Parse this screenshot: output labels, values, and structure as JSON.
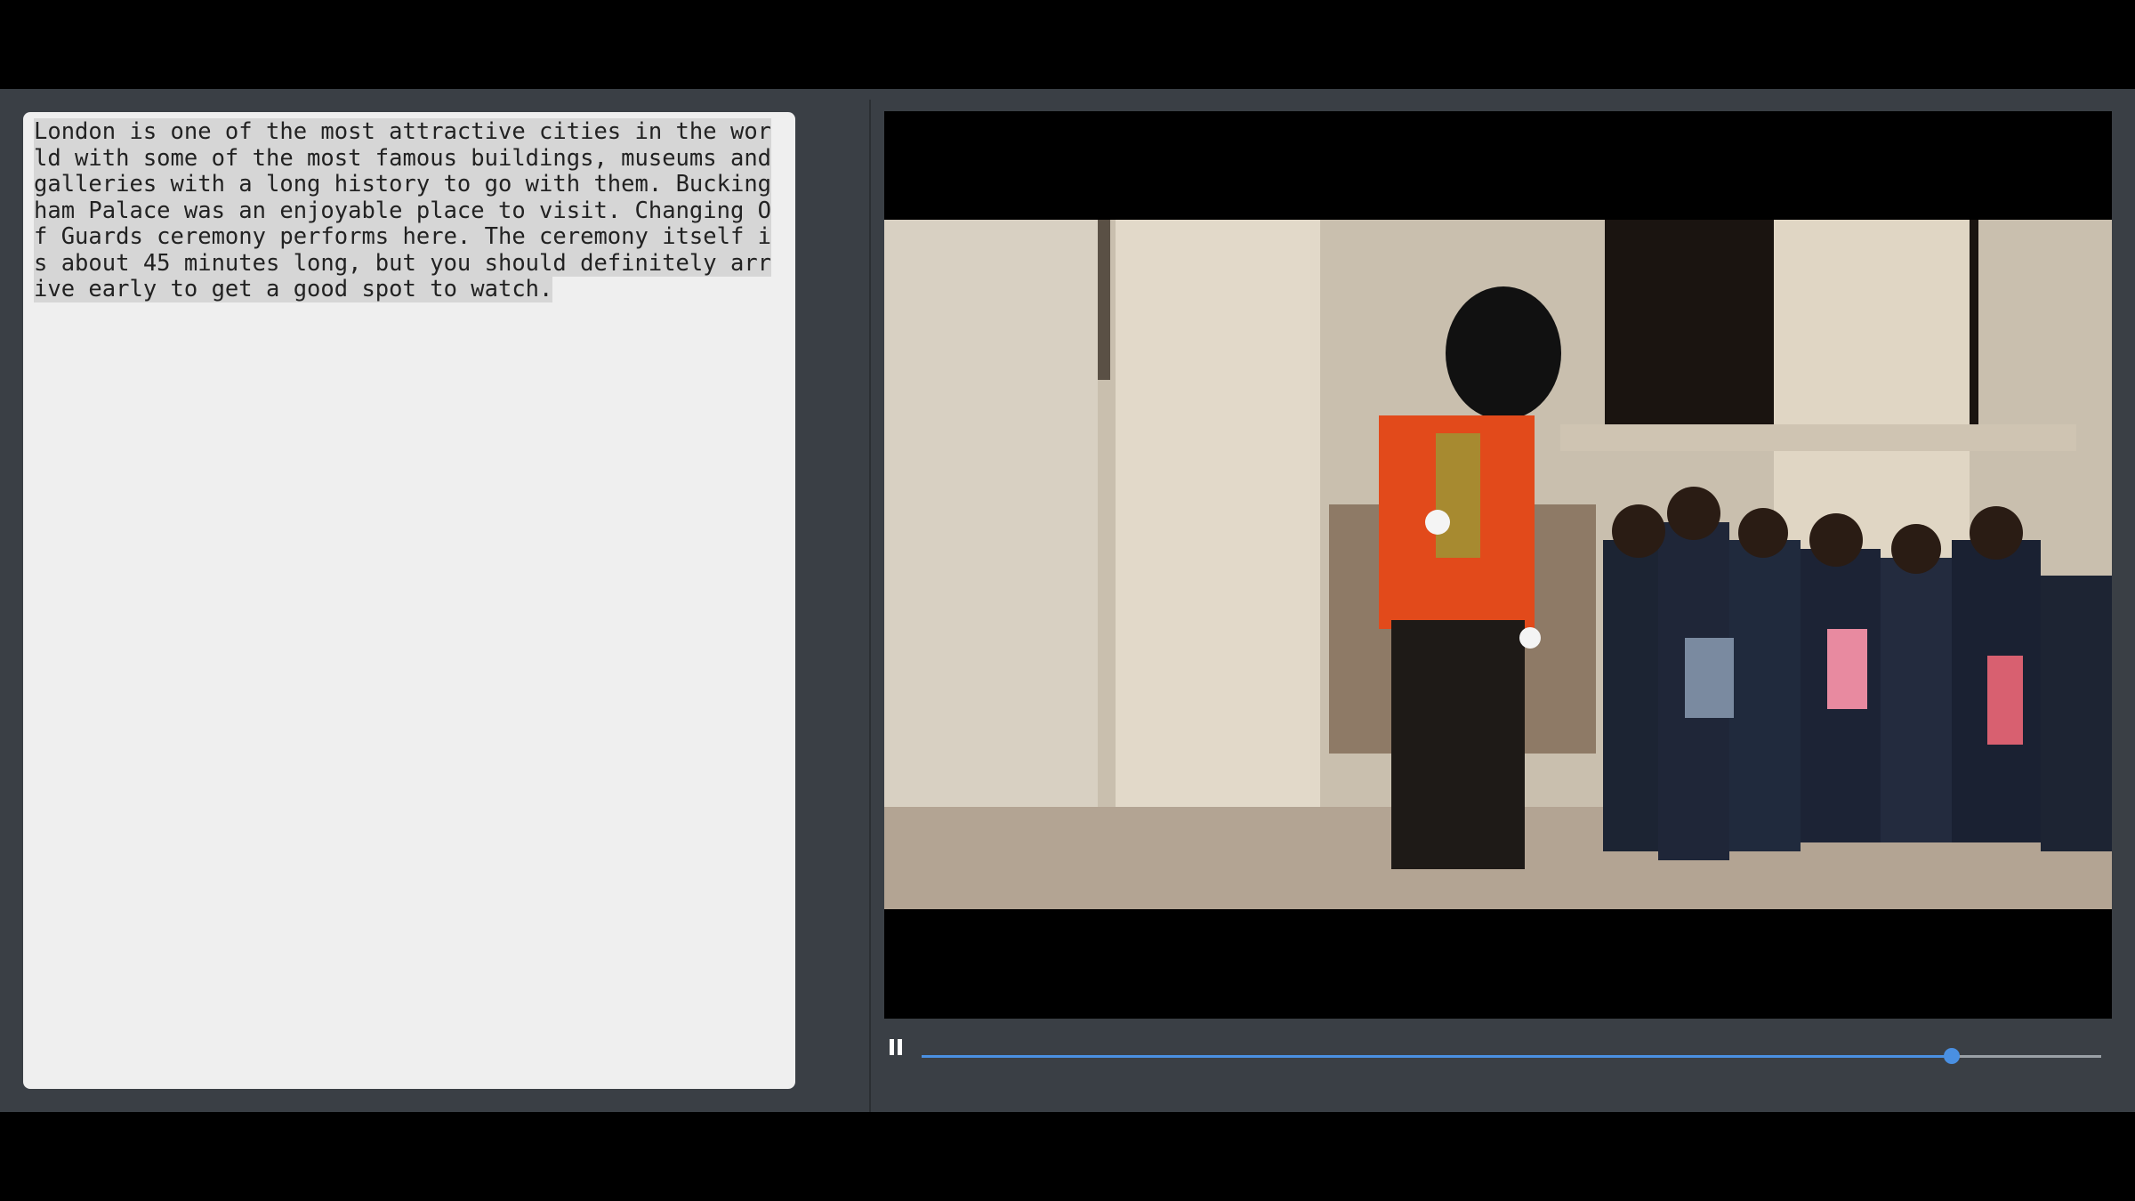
{
  "text_panel": {
    "segments": [
      "London is one of the most attractive cities in the world with some of the most famous buildings, museums and galleries with a long history to go with them.",
      " Buckingham Palace was an enjoyable place to visit.",
      " Changing Of Guards ceremony performs here.",
      " The ceremony itself is about 45 minutes long, but you should definitely arrive early to get a good spot to watch."
    ]
  },
  "video": {
    "state": "playing",
    "progress": 0.873
  },
  "icons": {
    "pause": "pause-icon",
    "cursor": "mouse-pointer-icon"
  },
  "colors": {
    "accent": "#4a90e2",
    "panel_bg": "#3a3f45",
    "text_panel_bg": "#efefef",
    "highlight": "#d6d6d6"
  }
}
